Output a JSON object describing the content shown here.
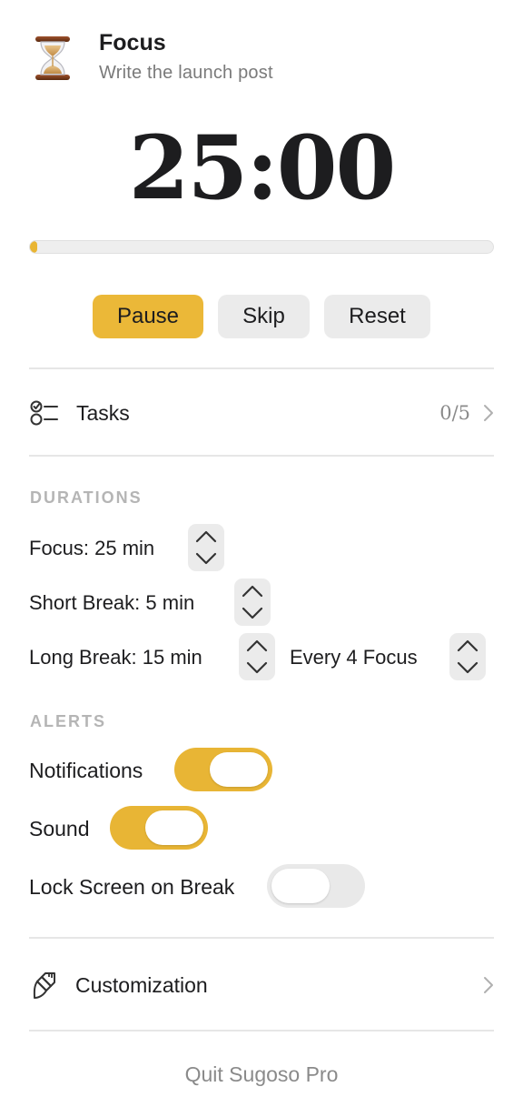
{
  "header": {
    "icon": "hourglass-icon",
    "title": "Focus",
    "subtitle": "Write the launch post"
  },
  "timer": {
    "display": "25:00",
    "progress_fraction": 0.01,
    "progress_color": "#e9b533"
  },
  "controls": {
    "pause_label": "Pause",
    "skip_label": "Skip",
    "reset_label": "Reset"
  },
  "tasks": {
    "label": "Tasks",
    "count": "0/5"
  },
  "durations": {
    "section_label": "DURATIONS",
    "focus_label": "Focus: 25 min",
    "short_break_label": "Short Break: 5 min",
    "long_break_label": "Long Break: 15 min",
    "every_label": "Every 4 Focus"
  },
  "alerts": {
    "section_label": "ALERTS",
    "notifications": {
      "label": "Notifications",
      "on": true
    },
    "sound": {
      "label": "Sound",
      "on": true
    },
    "lock_screen": {
      "label": "Lock Screen on Break",
      "on": false
    }
  },
  "customization": {
    "label": "Customization"
  },
  "quit_label": "Quit Sugoso Pro",
  "colors": {
    "accent": "#e9b533",
    "button_gray": "#ebebeb",
    "muted_text": "#8a8a8a",
    "section_text": "#b5b5b5"
  }
}
